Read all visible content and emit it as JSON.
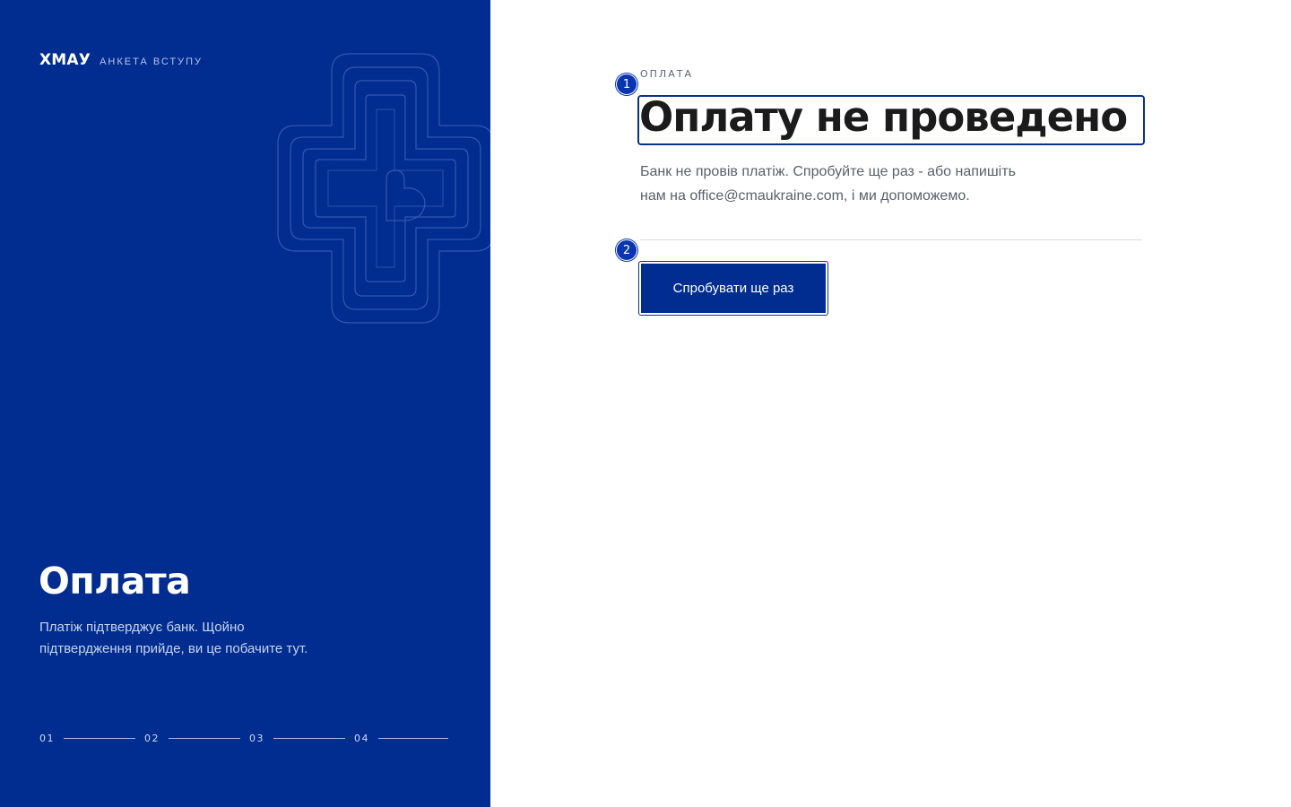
{
  "brand": {
    "name": "ХМАУ",
    "subtitle": "АНКЕТА ВСТУПУ"
  },
  "sidebar": {
    "title": "Оплата",
    "description": "Платіж підтверджує банк. Щойно підтвердження прийде, ви це побачите тут.",
    "steps": [
      "01",
      "02",
      "03",
      "04"
    ]
  },
  "main": {
    "eyebrow": "ОПЛАТА",
    "headline": "Оплату не проведено",
    "message_line1": "Банк не провів платіж. Спробуйте ще раз - або напишіть",
    "message_line2": "нам на office@cmaukraine.com, і ми допоможемо.",
    "retry_label": "Спробувати ще раз",
    "markers": [
      "1",
      "2"
    ]
  },
  "colors": {
    "brand_blue": "#002d8f",
    "marker_blue": "#0a35b0",
    "text_dark": "#1b1b1b",
    "text_muted": "#5a5f6a"
  },
  "icons": {
    "emblem": "cross-heart-emblem-icon"
  }
}
